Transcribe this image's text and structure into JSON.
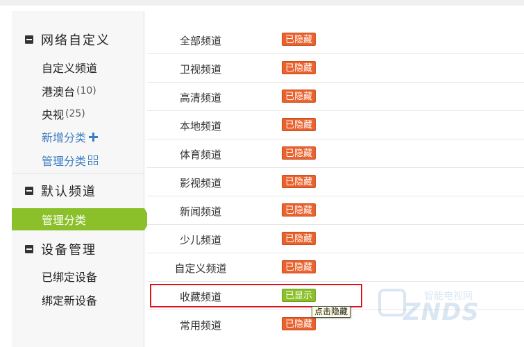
{
  "sidebar": {
    "groups": [
      {
        "title": "网络自定义",
        "items": [
          {
            "label": "自定义频道",
            "count": ""
          },
          {
            "label": "港澳台",
            "count": "(10)"
          },
          {
            "label": "央视",
            "count": "(25)"
          }
        ],
        "add_label": "新增分类",
        "manage_label": "管理分类"
      },
      {
        "title": "默认频道",
        "active_item": "管理分类"
      },
      {
        "title": "设备管理",
        "items": [
          {
            "label": "已绑定设备"
          },
          {
            "label": "绑定新设备"
          }
        ]
      }
    ]
  },
  "channels": [
    {
      "name": "全部频道",
      "status": "已隐藏"
    },
    {
      "name": "卫视频道",
      "status": "已隐藏"
    },
    {
      "name": "高清频道",
      "status": "已隐藏"
    },
    {
      "name": "本地频道",
      "status": "已隐藏"
    },
    {
      "name": "体育频道",
      "status": "已隐藏"
    },
    {
      "name": "影视频道",
      "status": "已隐藏"
    },
    {
      "name": "新闻频道",
      "status": "已隐藏"
    },
    {
      "name": "少儿频道",
      "status": "已隐藏"
    },
    {
      "name": "自定义频道",
      "status": "已隐藏"
    },
    {
      "name": "收藏频道",
      "status": "已显示"
    },
    {
      "name": "常用频道",
      "status": "已隐藏"
    }
  ],
  "tooltip": "点击隐藏",
  "watermark": {
    "brand": "ZNDS",
    "sub": "智能电视网"
  },
  "colors": {
    "hidden": "#e9622d",
    "shown": "#8bc02a",
    "link": "#3b7dc4",
    "highlight": "#e1141b"
  }
}
